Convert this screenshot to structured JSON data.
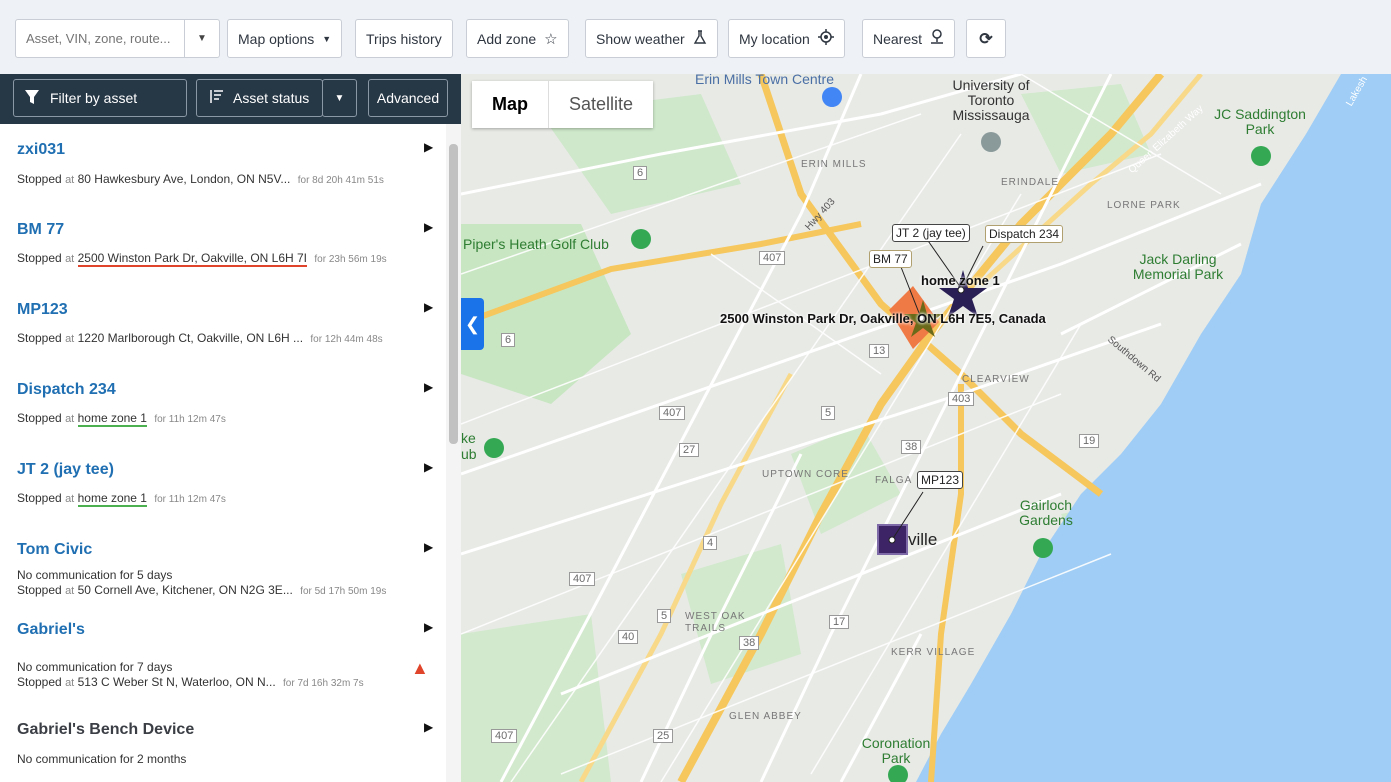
{
  "toolbar": {
    "search_placeholder": "Asset, VIN, zone, route...",
    "map_options": "Map options",
    "trips_history": "Trips history",
    "add_zone": "Add zone",
    "show_weather": "Show weather",
    "my_location": "My location",
    "nearest": "Nearest"
  },
  "panel": {
    "filter_by_asset": "Filter by asset",
    "asset_status": "Asset status",
    "advanced": "Advanced"
  },
  "assets": [
    {
      "name": "zxi031",
      "line1": "",
      "status": "Stopped",
      "at": "at",
      "location": "80 Hawkesbury Ave, London, ON N5V...",
      "duration": "for 8d 20h 41m 51s"
    },
    {
      "name": "BM 77",
      "line1": "",
      "status": "Stopped",
      "at": "at",
      "location": "2500 Winston Park Dr, Oakville, ON L6H 7I",
      "duration": "for 23h 56m 19s"
    },
    {
      "name": "MP123",
      "line1": "",
      "status": "Stopped",
      "at": "at",
      "location": "1220 Marlborough Ct, Oakville, ON L6H ...",
      "duration": "for 12h 44m 48s"
    },
    {
      "name": "Dispatch 234",
      "line1": "",
      "status": "Stopped",
      "at": "at",
      "location": "home zone 1",
      "duration": "for 11h 12m 47s"
    },
    {
      "name": "JT 2 (jay tee)",
      "line1": "",
      "status": "Stopped",
      "at": "at",
      "location": "home zone 1",
      "duration": "for 11h 12m 47s"
    },
    {
      "name": "Tom Civic",
      "line1": "No communication for 5 days",
      "status": "Stopped",
      "at": "at",
      "location": "50 Cornell Ave, Kitchener, ON N2G 3E...",
      "duration": "for 5d 17h 50m 19s"
    },
    {
      "name": "Gabriel's",
      "line1": "No communication for 7 days",
      "status": "Stopped",
      "at": "at",
      "location": "513 C Weber St N, Waterloo, ON N...",
      "duration": "for 7d 16h 32m 7s"
    },
    {
      "name": "Gabriel's Bench Device",
      "line1": "No communication for 2 months",
      "status": "",
      "at": "",
      "location": "",
      "duration": ""
    }
  ],
  "map": {
    "tab_map": "Map",
    "tab_satellite": "Satellite",
    "labels": {
      "erin_mills_centre": "Erin Mills Town Centre",
      "utm": "University of Toronto Mississauga",
      "jc_saddington": "JC Saddington Park",
      "erin_mills": "ERIN MILLS",
      "erindale": "ERINDALE",
      "lorne_park": "LORNE PARK",
      "queen_elizabeth": "Queen Elizabeth Way",
      "lakeshore": "Lakesh",
      "pipers_heath": "Piper's Heath Golf Club",
      "jack_darling": "Jack Darling Memorial Park",
      "southdown": "Southdown Rd",
      "clearview": "CLEARVIEW",
      "uptown_core": "UPTOWN CORE",
      "falga": "FALGA",
      "gairloch": "Gairloch Gardens",
      "oakville": "ville",
      "west_oak": "WEST OAK TRAILS",
      "kerr_village": "KERR VILLAGE",
      "glen_abbey": "GLEN ABBEY",
      "coronation": "Coronation Park",
      "hwy403": "Hwy 403",
      "ke": "ke",
      "ub": "ub"
    },
    "road_numbers": [
      "6",
      "407",
      "6",
      "13",
      "407",
      "5",
      "27",
      "38",
      "403",
      "19",
      "4",
      "407",
      "5",
      "17",
      "40",
      "38",
      "407",
      "25"
    ],
    "callouts": {
      "jt2": "JT 2 (jay tee)",
      "dispatch": "Dispatch 234",
      "bm77": "BM 77",
      "mp123": "MP123"
    },
    "address_label": "2500 Winston Park Dr, Oakville, ON L6H 7E5, Canada",
    "home_zone": "home zone 1"
  },
  "colors": {
    "header_bg": "#263746",
    "link": "#1f6fb2",
    "water": "#9fcdf5",
    "zone_orange": "#f07a45",
    "zone_purple": "#3d2466",
    "warning": "#e0442a"
  }
}
